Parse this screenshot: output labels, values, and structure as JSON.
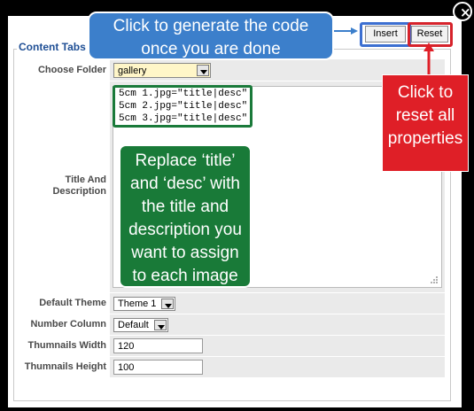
{
  "close_label": "×",
  "toolbar": {
    "insert_label": "Insert",
    "reset_label": "Reset"
  },
  "form": {
    "legend": "Content Tabs",
    "choose_folder": {
      "label": "Choose Folder",
      "value": "gallery"
    },
    "title_desc": {
      "label_line1": "Title And",
      "label_line2": "Description",
      "lines": [
        "5cm 1.jpg=\"title|desc\"",
        "5cm 2.jpg=\"title|desc\"",
        "5cm 3.jpg=\"title|desc\""
      ]
    },
    "default_theme": {
      "label": "Default Theme",
      "value": "Theme 1"
    },
    "number_column": {
      "label": "Number Column",
      "value": "Default"
    },
    "thumb_width": {
      "label": "Thumnails Width",
      "value": "120"
    },
    "thumb_height": {
      "label": "Thumnails Height",
      "value": "100"
    }
  },
  "callouts": {
    "blue": {
      "line1": "Click to generate the code",
      "line2": "once you are done"
    },
    "red": {
      "line1": "Click to",
      "line2": "reset all",
      "line3": "properties"
    },
    "green": {
      "line1": "Replace ‘title’",
      "line2": "and ‘desc’ with",
      "line3": "the title and",
      "line4": "description you",
      "line5": "want to assign",
      "line6": "to each image"
    }
  },
  "colors": {
    "blue": "#3c7fcb",
    "red": "#df1f27",
    "green": "#197a38",
    "legend": "#1f4f95"
  }
}
